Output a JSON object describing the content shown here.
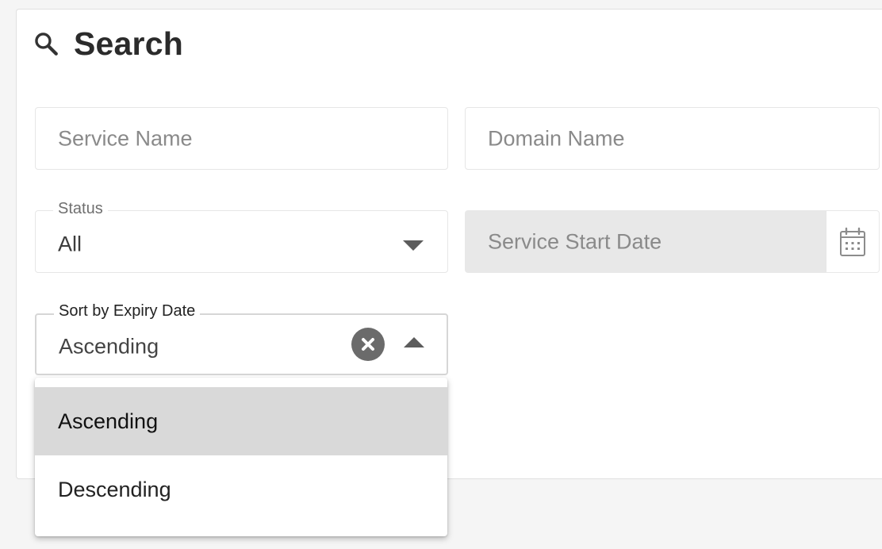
{
  "header": {
    "icon": "search-icon",
    "title": "Search"
  },
  "fields": {
    "service_name": {
      "placeholder": "Service Name"
    },
    "domain_name": {
      "placeholder": "Domain Name"
    },
    "status": {
      "label": "Status",
      "value": "All"
    },
    "service_start_date": {
      "placeholder": "Service Start Date",
      "icon": "calendar-icon"
    },
    "sort_by_expiry": {
      "label": "Sort by Expiry Date",
      "value": "Ascending"
    }
  },
  "sort_menu": {
    "options": [
      {
        "label": "Ascending",
        "selected": true
      },
      {
        "label": "Descending",
        "selected": false
      }
    ]
  },
  "colors": {
    "selected_option_bg": "#d9d9d9",
    "disabled_field_bg": "#e8e8e8",
    "text_primary": "#2b2b2b"
  }
}
